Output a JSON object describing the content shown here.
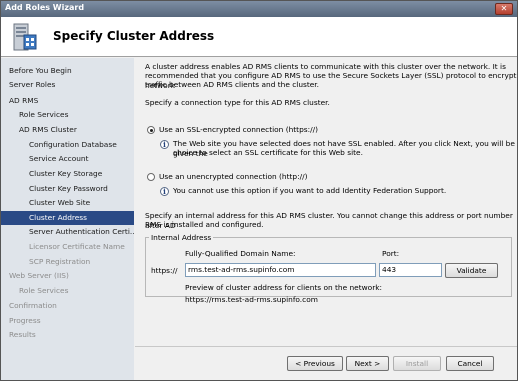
{
  "window": {
    "title": "Add Roles Wizard",
    "close_glyph": "✕"
  },
  "header": {
    "page_title": "Specify Cluster Address",
    "icon": "server-role-icon"
  },
  "nav": {
    "items": [
      {
        "label": "Before You Begin",
        "state": "normal"
      },
      {
        "label": "Server Roles",
        "state": "normal"
      },
      {
        "label": "AD RMS",
        "state": "normal"
      },
      {
        "label": "Role Services",
        "state": "normal"
      },
      {
        "label": "AD RMS Cluster",
        "state": "normal"
      },
      {
        "label": "Configuration Database",
        "state": "normal"
      },
      {
        "label": "Service Account",
        "state": "normal"
      },
      {
        "label": "Cluster Key Storage",
        "state": "normal"
      },
      {
        "label": "Cluster Key Password",
        "state": "normal"
      },
      {
        "label": "Cluster Web Site",
        "state": "normal"
      },
      {
        "label": "Cluster Address",
        "state": "selected"
      },
      {
        "label": "Server Authentication Certi...",
        "state": "normal"
      },
      {
        "label": "Licensor Certificate Name",
        "state": "disabled"
      },
      {
        "label": "SCP Registration",
        "state": "disabled"
      },
      {
        "label": "Web Server (IIS)",
        "state": "disabled"
      },
      {
        "label": "Role Services",
        "state": "disabled"
      },
      {
        "label": "Confirmation",
        "state": "disabled"
      },
      {
        "label": "Progress",
        "state": "disabled"
      },
      {
        "label": "Results",
        "state": "disabled"
      }
    ]
  },
  "content": {
    "intro": [
      "A cluster address enables AD RMS clients to communicate with this cluster over the network. It is",
      "recommended that you configure AD RMS to use the Secure Sockets Layer (SSL) protocol to encrypt network",
      "traffic between AD RMS clients and the cluster."
    ],
    "connection_prompt": "Specify a connection type for this AD RMS cluster.",
    "ssl_option": {
      "label": "Use an SSL-encrypted connection (https://)",
      "checked": true,
      "info": [
        "The Web site you have selected does not have SSL enabled. After you click Next, you will be given the",
        "choice to select an SSL certificate for this Web site."
      ]
    },
    "http_option": {
      "label": "Use an unencrypted connection (http://)",
      "checked": false,
      "info": "You cannot use this option if you want to add Identity Federation Support."
    },
    "address_prompt": [
      "Specify an internal address for this AD RMS cluster. You cannot change this address or port number after AD",
      "RMS is installed and configured."
    ],
    "internal_address": {
      "group_label": "Internal Address",
      "fqdn_label": "Fully-Qualified Domain Name:",
      "port_label": "Port:",
      "scheme": "https://",
      "fqdn_value": "rms.test-ad-rms.supinfo.com",
      "port_value": "443",
      "validate_label": "Validate",
      "preview_label": "Preview of cluster address for clients on the network:",
      "preview_value": "https://rms.test-ad-rms.supinfo.com"
    },
    "buttons": {
      "previous": "< Previous",
      "next": "Next >",
      "install": "Install",
      "cancel": "Cancel"
    }
  }
}
